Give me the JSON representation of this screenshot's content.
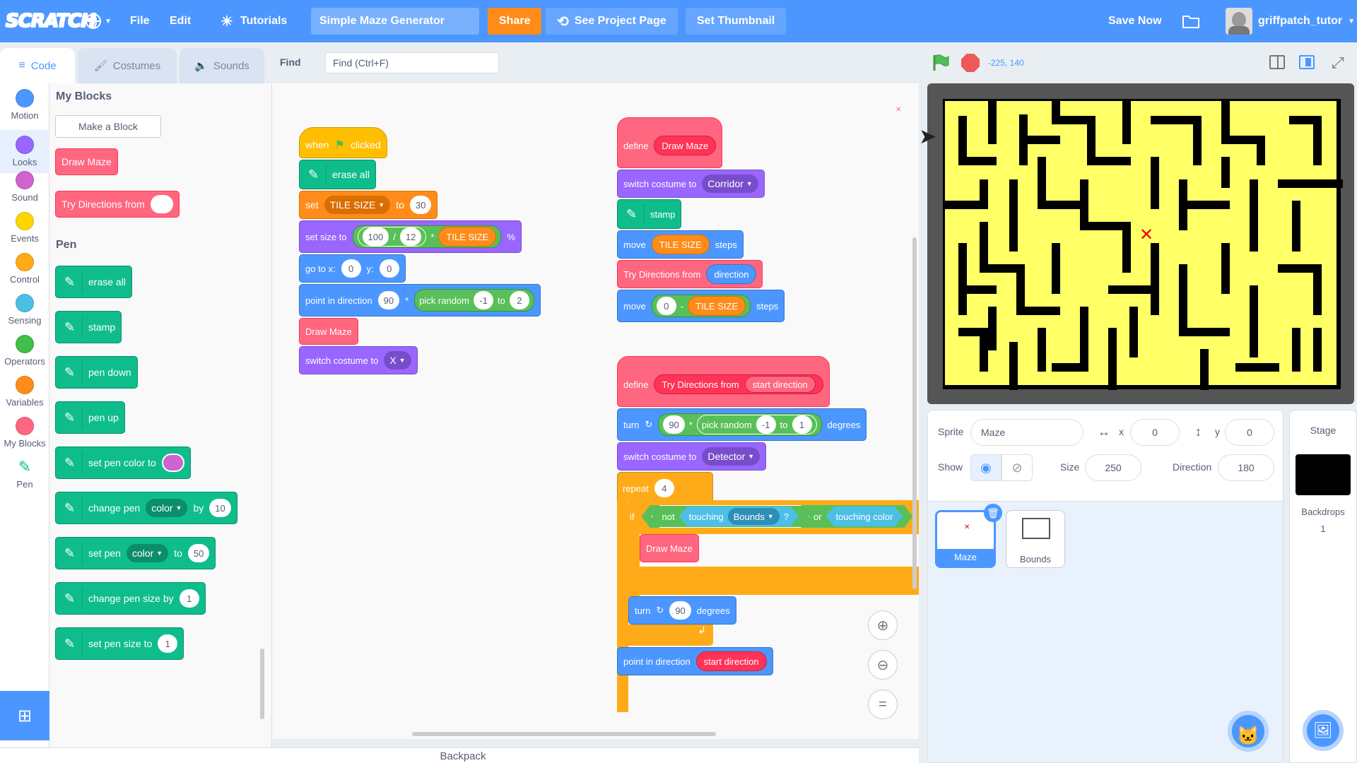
{
  "menubar": {
    "logo": "SCRATCH",
    "file": "File",
    "edit": "Edit",
    "tutorials": "Tutorials",
    "project_title": "Simple Maze Generator",
    "share": "Share",
    "see_project_page": "See Project Page",
    "set_thumbnail": "Set Thumbnail",
    "save_now": "Save Now",
    "username": "griffpatch_tutor"
  },
  "tabs": {
    "code": "Code",
    "costumes": "Costumes",
    "sounds": "Sounds"
  },
  "find": {
    "label": "Find",
    "placeholder": "Find (Ctrl+F)"
  },
  "stage_controls": {
    "coords": "-225, 140"
  },
  "categories": [
    {
      "label": "Motion",
      "color": "#4c97ff"
    },
    {
      "label": "Looks",
      "color": "#9966ff"
    },
    {
      "label": "Sound",
      "color": "#cf63cf"
    },
    {
      "label": "Events",
      "color": "#ffd500"
    },
    {
      "label": "Control",
      "color": "#ffab19"
    },
    {
      "label": "Sensing",
      "color": "#4cbfe6"
    },
    {
      "label": "Operators",
      "color": "#40bf4a"
    },
    {
      "label": "Variables",
      "color": "#ff8c1a"
    },
    {
      "label": "My Blocks",
      "color": "#ff6680"
    },
    {
      "label": "Pen",
      "color": "#0fbd8c"
    }
  ],
  "palette": {
    "my_blocks_heading": "My Blocks",
    "make_a_block": "Make a Block",
    "draw_maze": "Draw Maze",
    "try_directions_from": "Try Directions from",
    "pen_heading": "Pen",
    "erase_all": "erase all",
    "stamp": "stamp",
    "pen_down": "pen down",
    "pen_up": "pen up",
    "set_pen_color_to": "set pen color to",
    "change_pen": "change pen",
    "color": "color",
    "by": "by",
    "by_val": "10",
    "set_pen": "set pen",
    "to": "to",
    "set_pen_val": "50",
    "change_pen_size_by": "change pen size by",
    "change_pen_size_val": "1",
    "set_pen_size_to": "set pen size to",
    "set_pen_size_val": "1"
  },
  "script1": {
    "when": "when",
    "clicked": "clicked",
    "erase_all": "erase all",
    "set": "set",
    "tile_size": "TILE SIZE",
    "to": "to",
    "set_val": "30",
    "set_size_to": "set size to",
    "n100": "100",
    "div": "/",
    "n12": "12",
    "mul": "*",
    "percent": "%",
    "go_to_x": "go to x:",
    "x_val": "0",
    "y": "y:",
    "y_val": "0",
    "point_in_direction": "point in direction",
    "n90": "90",
    "pick_random": "pick random",
    "neg1": "-1",
    "n2": "2",
    "draw_maze": "Draw Maze",
    "switch_costume_to": "switch costume to",
    "costume_x": "X"
  },
  "script2": {
    "define": "define",
    "draw_maze": "Draw Maze",
    "switch_costume_to": "switch costume to",
    "corridor": "Corridor",
    "stamp": "stamp",
    "move": "move",
    "tile_size": "TILE SIZE",
    "steps": "steps",
    "try_directions_from": "Try Directions from",
    "direction": "direction",
    "zero": "0",
    "minus": "-"
  },
  "script3": {
    "define": "define",
    "try_directions_from": "Try Directions from",
    "start_direction": "start direction",
    "turn": "turn",
    "n90": "90",
    "mul": "*",
    "pick_random": "pick random",
    "neg1": "-1",
    "to": "to",
    "n1": "1",
    "degrees": "degrees",
    "switch_costume_to": "switch costume to",
    "detector": "Detector",
    "repeat": "repeat",
    "repeat_val": "4",
    "if": "if",
    "not": "not",
    "touching": "touching",
    "bounds": "Bounds",
    "q": "?",
    "or": "or",
    "touching_color": "touching color",
    "draw_maze": "Draw Maze",
    "point_in_direction": "point in direction"
  },
  "sprite_info": {
    "sprite_label": "Sprite",
    "sprite_name": "Maze",
    "x_label": "x",
    "x_val": "0",
    "y_label": "y",
    "y_val": "0",
    "show_label": "Show",
    "size_label": "Size",
    "size_val": "250",
    "direction_label": "Direction",
    "direction_val": "180"
  },
  "sprites": [
    {
      "name": "Maze"
    },
    {
      "name": "Bounds"
    }
  ],
  "stage_panel": {
    "title": "Stage",
    "backdrops_label": "Backdrops",
    "backdrops_count": "1"
  },
  "backpack": "Backpack",
  "colors": {
    "menubar": "#4c97ff",
    "maze_yellow": "#ffff66",
    "maze_wall": "#000000"
  }
}
